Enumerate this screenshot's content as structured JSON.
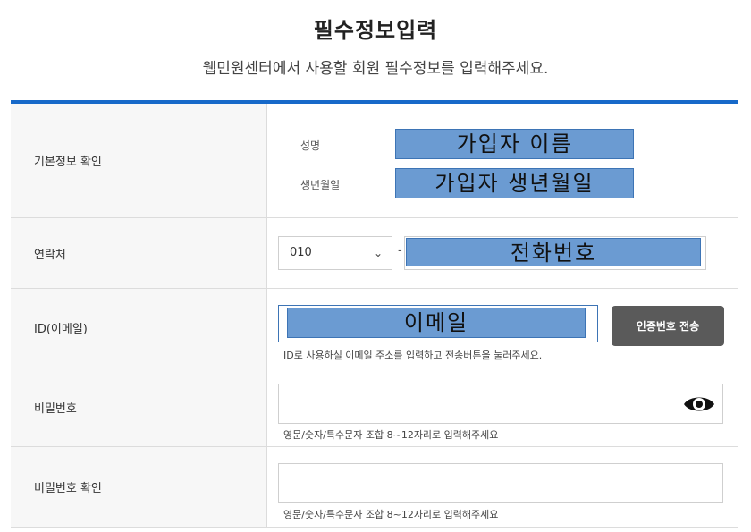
{
  "header": {
    "title": "필수정보입력",
    "subtitle": "웹민원센터에서 사용할 회원 필수정보를 입력해주세요."
  },
  "basic_info": {
    "label": "기본정보 확인",
    "name_label": "성명",
    "name_value": "가입자 이름",
    "birth_label": "생년월일",
    "birth_value": "가입자 생년월일"
  },
  "contact": {
    "label": "연락처",
    "prefix_selected": "010",
    "separator": "-",
    "phone_value": "전화번호"
  },
  "email": {
    "label": "ID(이메일)",
    "value": "이메일",
    "send_button": "인증번호 전송",
    "hint": "ID로 사용하실 이메일 주소를 입력하고 전송버튼을 눌러주세요."
  },
  "password": {
    "label": "비밀번호",
    "hint": "영문/숫자/특수문자 조합 8~12자리로 입력해주세요",
    "toggle_icon": "eye-icon"
  },
  "password_confirm": {
    "label": "비밀번호 확인",
    "hint": "영문/숫자/특수문자 조합 8~12자리로 입력해주세요"
  },
  "colors": {
    "accent": "#1769c9",
    "redaction": "#6b9bd2",
    "button": "#5a5a5a"
  }
}
